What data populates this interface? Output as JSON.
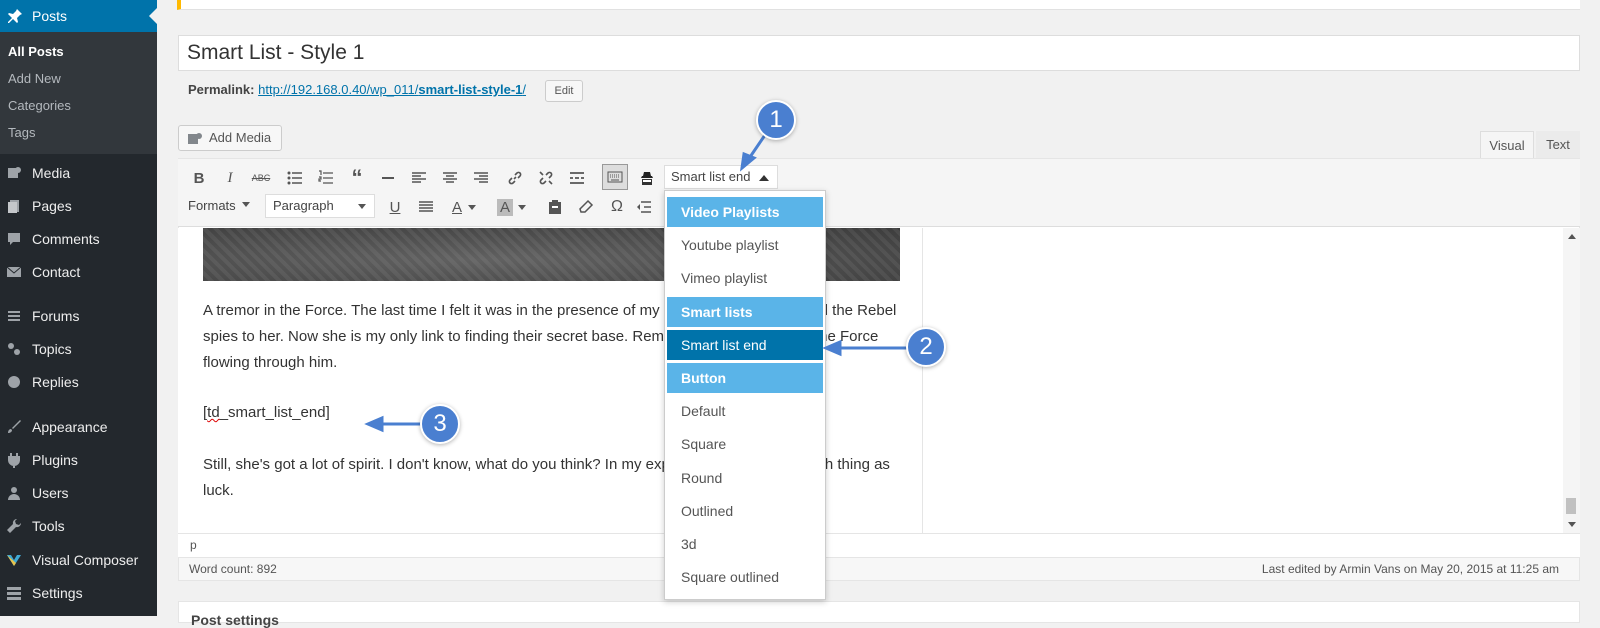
{
  "sidebar": {
    "posts_label": "Posts",
    "submenu": [
      "All Posts",
      "Add New",
      "Categories",
      "Tags"
    ],
    "items": [
      "Media",
      "Pages",
      "Comments",
      "Contact",
      "Forums",
      "Topics",
      "Replies",
      "Appearance",
      "Plugins",
      "Users",
      "Tools",
      "Visual Composer",
      "Settings"
    ]
  },
  "post": {
    "title": "Smart List - Style 1",
    "permalink_label": "Permalink:",
    "permalink_base": "http://192.168.0.40/wp_011/",
    "permalink_slug": "smart-list-style-1",
    "permalink_end": "/",
    "edit_label": "Edit"
  },
  "editor": {
    "add_media_label": "Add Media",
    "tab_visual": "Visual",
    "tab_text": "Text",
    "smart_list_value": "Smart list end",
    "formats_label": "Formats",
    "paragraph_value": "Paragraph",
    "text_color_glyph": "A",
    "bg_color_glyph": "A",
    "omega_glyph": "Ω",
    "para1": "A tremor in the Force. The last time I felt it was in the presence of my old master. I have traced the Rebel spies to her. Now she is my only link to finding their secret base. Remember, a Jedi can feel the Force flowing through him.",
    "shortcode_open": "[",
    "shortcode_td": "td",
    "shortcode_rest": "_smart_list_end]",
    "para3": "Still, she's got a lot of spirit. I don't know, what do you think? In my experience, there is no such thing as luck.",
    "path": "p",
    "word_count": "Word count: 892",
    "last_edited": "Last edited by Armin Vans on May 20, 2015 at 11:25 am"
  },
  "dropdown": {
    "items": [
      {
        "label": "Video Playlists",
        "kind": "head"
      },
      {
        "label": "Youtube playlist",
        "kind": "item"
      },
      {
        "label": "Vimeo playlist",
        "kind": "item"
      },
      {
        "label": "Smart lists",
        "kind": "head"
      },
      {
        "label": "Smart list end",
        "kind": "selected"
      },
      {
        "label": "Button",
        "kind": "head"
      },
      {
        "label": "Default",
        "kind": "item"
      },
      {
        "label": "Square",
        "kind": "item"
      },
      {
        "label": "Round",
        "kind": "item"
      },
      {
        "label": "Outlined",
        "kind": "item"
      },
      {
        "label": "3d",
        "kind": "item"
      },
      {
        "label": "Square outlined",
        "kind": "item"
      }
    ]
  },
  "callouts": [
    "1",
    "2",
    "3"
  ],
  "bottom_box_title": "Post settings",
  "colors": {
    "sidebar": "#23282d",
    "active": "#0073aa",
    "dropdown_head": "#5ab4e8",
    "callout": "#4a7fd0"
  }
}
